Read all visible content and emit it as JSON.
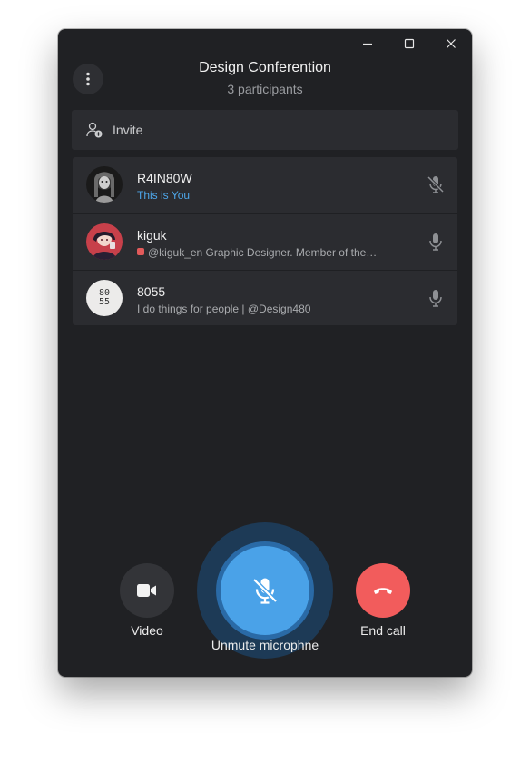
{
  "window": {
    "title": "Design Conferention",
    "subtitle": "3 participants",
    "controls": [
      "minimize-icon",
      "maximize-icon",
      "close-icon"
    ]
  },
  "invite": {
    "label": "Invite",
    "icon": "add-person-icon"
  },
  "participants": [
    {
      "name": "R4IN80W",
      "status": "This is You",
      "mic": "mic-off-icon",
      "avatar": "grayscale-portrait"
    },
    {
      "name": "kiguk",
      "status": "@kiguk_en  Graphic Designer. Member of the…",
      "mic": "mic-icon",
      "avatar": "red-anime-portrait"
    },
    {
      "name": "8055",
      "status": "I do things for people | @Design480",
      "mic": "mic-icon",
      "avatar_text_top": "80",
      "avatar_text_bottom": "55"
    }
  ],
  "controls": {
    "video_label": "Video",
    "unmute_label": "Unmute microphne",
    "end_call_label": "End call"
  },
  "colors": {
    "accent": "#4aa2e8",
    "end_call": "#f25c5c",
    "window_bg": "#202124",
    "panel_bg": "#2b2c30"
  }
}
